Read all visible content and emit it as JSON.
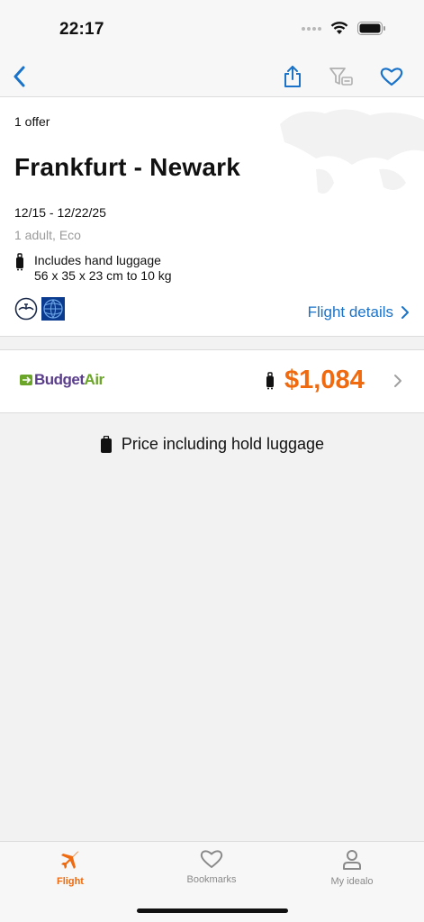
{
  "status_bar": {
    "time": "22:17"
  },
  "offer": {
    "count_label": "1 offer",
    "route": "Frankfurt - Newark",
    "dates": "12/15 - 12/22/25",
    "passengers": "1 adult, Eco",
    "luggage_line1": "Includes hand luggage",
    "luggage_line2": "56 x 35 x 23 cm to 10 kg",
    "airlines": [
      "lufthansa-logo",
      "united-airlines-logo"
    ],
    "flight_details_label": "Flight details"
  },
  "price_row": {
    "provider": "BudgetAir",
    "price": "$1,084",
    "price_color": "#f06a0f"
  },
  "hold_note": "Price including hold luggage",
  "tabs": [
    {
      "label": "Flight",
      "icon": "airplane-icon",
      "active": true
    },
    {
      "label": "Bookmarks",
      "icon": "heart-icon",
      "active": false
    },
    {
      "label": "My idealo",
      "icon": "person-icon",
      "active": false
    }
  ],
  "colors": {
    "accent": "#f06a0f",
    "link": "#1a73c9"
  }
}
